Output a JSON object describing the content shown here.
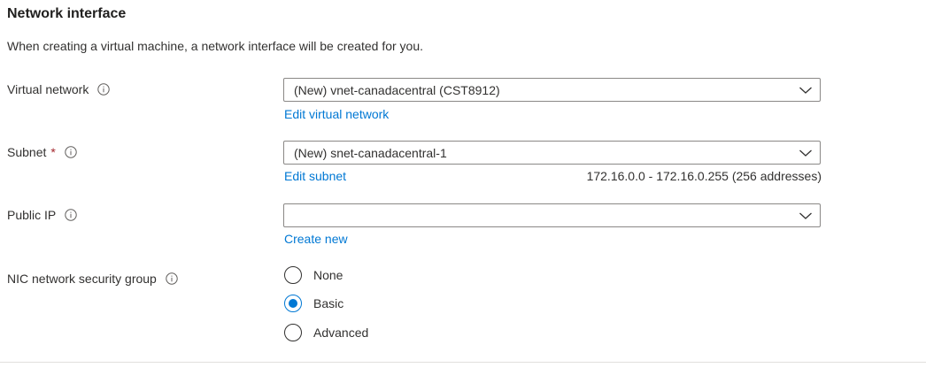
{
  "section": {
    "title": "Network interface",
    "description": "When creating a virtual machine, a network interface will be created for you."
  },
  "fields": {
    "virtual_network": {
      "label": "Virtual network",
      "value": "(New) vnet-canadacentral (CST8912)",
      "link": "Edit virtual network"
    },
    "subnet": {
      "label": "Subnet",
      "required_mark": "*",
      "value": "(New) snet-canadacentral-1",
      "link": "Edit subnet",
      "range": "172.16.0.0 - 172.16.0.255 (256 addresses)"
    },
    "public_ip": {
      "label": "Public IP",
      "value": "",
      "link": "Create new"
    },
    "nsg": {
      "label": "NIC network security group",
      "options": [
        "None",
        "Basic",
        "Advanced"
      ],
      "selected": "Basic"
    }
  },
  "colors": {
    "link": "#0078d4",
    "radio_selected": "#0078d4",
    "required": "#a4262c",
    "border": "#8a8886"
  },
  "icons": {
    "info": "info-icon",
    "chevron": "chevron-down-icon"
  }
}
